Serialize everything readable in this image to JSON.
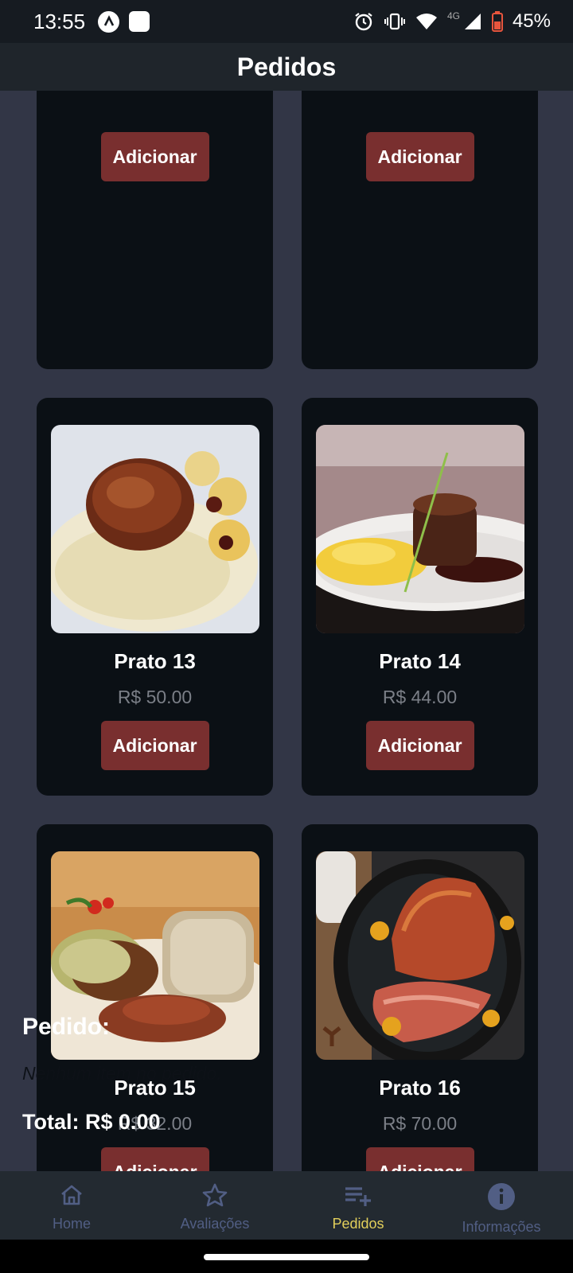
{
  "status_bar": {
    "time": "13:55",
    "network": "4G",
    "battery": "45%",
    "icons": [
      "app-a-icon",
      "app-square-icon",
      "alarm-icon",
      "vibrate-icon",
      "wifi-icon",
      "signal-icon",
      "battery-icon"
    ]
  },
  "header": {
    "title": "Pedidos"
  },
  "menu": {
    "items": [
      {
        "name": "",
        "price": "",
        "button": "Adicionar"
      },
      {
        "name": "",
        "price": "",
        "button": "Adicionar"
      },
      {
        "name": "Prato 13",
        "price": "R$ 50.00",
        "button": "Adicionar"
      },
      {
        "name": "Prato 14",
        "price": "R$ 44.00",
        "button": "Adicionar"
      },
      {
        "name": "Prato 15",
        "price": "R$ 32.00",
        "button": "Adicionar"
      },
      {
        "name": "Prato 16",
        "price": "R$ 70.00",
        "button": "Adicionar"
      }
    ]
  },
  "order": {
    "title": "Pedido:",
    "empty_text": "Nenhum item no pedido.",
    "total": "Total: R$ 0.00"
  },
  "nav": {
    "items": [
      {
        "label": "Home",
        "icon": "home-icon"
      },
      {
        "label": "Avaliações",
        "icon": "star-icon"
      },
      {
        "label": "Pedidos",
        "icon": "playlist-add-icon",
        "active": true
      },
      {
        "label": "Informações",
        "icon": "info-icon"
      }
    ]
  },
  "colors": {
    "background": "#323646",
    "card": "#0b1015",
    "button": "#792f2f",
    "active_tab": "#e2cf5b",
    "inactive_tab": "#515e84"
  }
}
